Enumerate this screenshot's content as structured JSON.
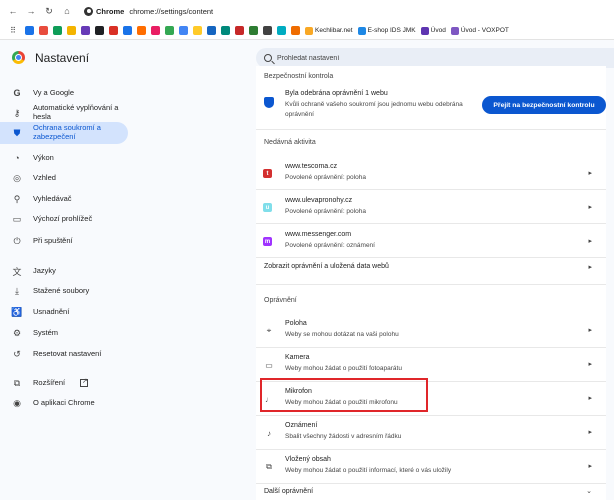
{
  "browser": {
    "chip_label": "Chrome",
    "url": "chrome://settings/content",
    "bookmarks": [
      {
        "label": "",
        "color": "#1a73e8"
      },
      {
        "label": "",
        "color": "#e84c3d"
      },
      {
        "label": "",
        "color": "#0f9d58"
      },
      {
        "label": "",
        "color": "#f4b400"
      },
      {
        "label": "",
        "color": "#673ab7"
      },
      {
        "label": "",
        "color": "#202124"
      },
      {
        "label": "",
        "color": "#d93025"
      },
      {
        "label": "",
        "color": "#1a73e8"
      },
      {
        "label": "",
        "color": "#ff6d00"
      },
      {
        "label": "",
        "color": "#e91e63"
      },
      {
        "label": "",
        "color": "#34a853"
      },
      {
        "label": "",
        "color": "#4285f4"
      },
      {
        "label": "",
        "color": "#ffca28"
      },
      {
        "label": "",
        "color": "#1565c0"
      },
      {
        "label": "",
        "color": "#00897b"
      },
      {
        "label": "",
        "color": "#c62828"
      },
      {
        "label": "",
        "color": "#2e7d32"
      },
      {
        "label": "",
        "color": "#424242"
      },
      {
        "label": "",
        "color": "#00acc1"
      },
      {
        "label": "",
        "color": "#ef6c00"
      }
    ],
    "bookmark_labels": {
      "kechlibar": "Kechlibar.net",
      "eshop": "E-shop IDS JMK",
      "uvod": "Úvod",
      "voxpot": "Úvod - VOXPOT"
    }
  },
  "header": {
    "title": "Nastavení",
    "search_placeholder": "Prohledat nastavení"
  },
  "sidebar": {
    "items": [
      {
        "label": "Vy a Google",
        "icon": "google-icon"
      },
      {
        "label": "Automatické vyplňování a hesla",
        "icon": "key-icon"
      },
      {
        "label": "Ochrana soukromí a zabezpečení",
        "icon": "shield-icon",
        "active": true
      },
      {
        "label": "Výkon",
        "icon": "speedometer-icon"
      },
      {
        "label": "Vzhled",
        "icon": "palette-icon"
      },
      {
        "label": "Vyhledávač",
        "icon": "search-icon"
      },
      {
        "label": "Výchozí prohlížeč",
        "icon": "browser-icon"
      },
      {
        "label": "Při spuštění",
        "icon": "power-icon"
      },
      {
        "label": "Jazyky",
        "icon": "translate-icon"
      },
      {
        "label": "Stažené soubory",
        "icon": "download-icon"
      },
      {
        "label": "Usnadnění",
        "icon": "accessibility-icon"
      },
      {
        "label": "Systém",
        "icon": "wrench-icon"
      },
      {
        "label": "Resetovat nastavení",
        "icon": "reset-icon"
      },
      {
        "label": "Rozšíření",
        "icon": "puzzle-icon"
      },
      {
        "label": "O aplikaci Chrome",
        "icon": "chrome-icon"
      }
    ]
  },
  "main": {
    "safety": {
      "heading": "Bezpečnostní kontrola",
      "title": "Byla odebrána oprávnění 1 webu",
      "desc_line1": "Kvůli ochraně vašeho soukromí jsou jednomu webu odebrána",
      "desc_line2": "oprávnění",
      "button": "Přejít na bezpečnostní kontrolu"
    },
    "recent": {
      "heading": "Nedávná aktivita",
      "items": [
        {
          "site": "www.tescoma.cz",
          "detail": "Povolené oprávnění: poloha",
          "color": "#d32f2f",
          "glyph": "t"
        },
        {
          "site": "www.ulevapronohy.cz",
          "detail": "Povolené oprávnění: poloha",
          "color": "#80deea",
          "glyph": "u"
        },
        {
          "site": "www.messenger.com",
          "detail": "Povolené oprávnění: oznámení",
          "color": "#a033ff",
          "glyph": "m"
        }
      ],
      "view_all": "Zobrazit oprávnění a uložená data webů"
    },
    "permissions": {
      "heading": "Oprávnění",
      "items": [
        {
          "title": "Poloha",
          "desc": "Weby se mohou dotázat na vaši polohu",
          "icon": "location-pin-icon"
        },
        {
          "title": "Kamera",
          "desc": "Weby mohou žádat o použití fotoaparátu",
          "icon": "camera-icon"
        },
        {
          "title": "Mikrofon",
          "desc": "Weby mohou žádat o použití mikrofonu",
          "icon": "microphone-icon"
        },
        {
          "title": "Oznámení",
          "desc": "Sbalit všechny žádosti v adresním řádku",
          "icon": "bell-icon"
        },
        {
          "title": "Vložený obsah",
          "desc": "Weby mohou žádat o použití informací, které o vás uložily",
          "icon": "embedded-content-icon"
        }
      ],
      "more": "Další oprávnění"
    }
  },
  "colors": {
    "accent": "#0b57d0",
    "highlight": "#e0262a"
  }
}
